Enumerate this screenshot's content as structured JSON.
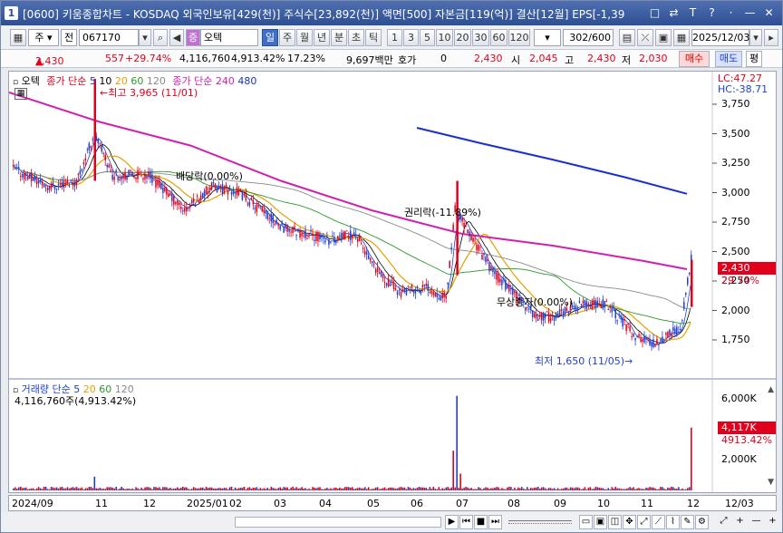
{
  "window": {
    "icon_label": "1",
    "title": "[0600] 키움종합차트 - KOSDAQ 외국인보유[429(천)] 주식수[23,892(천)] 액면[500] 자본금[119(억)] 결산[12월] EPS[-1,39",
    "title_buttons": [
      "□",
      "⇄",
      "T",
      "?",
      "·",
      "—",
      "✕"
    ]
  },
  "toolbar": {
    "market_type": "주",
    "board": "전",
    "stock_code": "067170",
    "stock_name": "오텍",
    "stock_tag": "증",
    "periods": [
      "일",
      "주",
      "월",
      "년",
      "분",
      "초",
      "틱"
    ],
    "active_period": "일",
    "intervals": [
      "1",
      "3",
      "5",
      "10",
      "20",
      "30",
      "60",
      "120"
    ],
    "view_count": "302",
    "view_total": "/600",
    "date": "2025/12/03"
  },
  "quote": {
    "price": "2,430",
    "change": "557",
    "change_rate": "+29.74%",
    "volume": "4,116,760",
    "volume_rate": "4,913.42%",
    "turnover": "17.23%",
    "amount": "9,697백만",
    "hoga_label": "호가",
    "hoga_value": "0",
    "hoga_price": "2,430",
    "open_label": "시",
    "open": "2,045",
    "high_label": "고",
    "high": "2,430",
    "low_label": "저",
    "low": "2,030",
    "buy_button": "매수",
    "sell_button": "매도",
    "eval_button": "평"
  },
  "colors": {
    "up": "#e0001b",
    "down": "#1f3fcf",
    "ma5": "#1f3fcf",
    "ma10": "#000000",
    "ma20": "#e8a000",
    "ma60": "#2a9a2a",
    "ma120": "#8a8a8a",
    "ma240": "#d020b0",
    "ma480": "#1a2fcf"
  },
  "price_panel": {
    "stock_label": "오텍",
    "legend_1": "종가 단순",
    "ma_1": [
      "5",
      "10",
      "20",
      "60",
      "120"
    ],
    "legend_2": "종가 단순",
    "ma_2": [
      "240",
      "480"
    ],
    "lc": "LC:47.27",
    "hc": "HC:-38.71",
    "high_note": "최고 3,965 (11/01)",
    "low_note": "최저 1,650 (11/05)",
    "dividend_note": "배당락(0.00%)",
    "rights_note": "권리락(-11.89%)",
    "bonus_note": "무상증자(0.00%)",
    "y_ticks": [
      "3,750",
      "3,500",
      "3,250",
      "3,000",
      "2,750",
      "2,500",
      "2,250",
      "2,000",
      "1,750"
    ],
    "last_price": "2,430",
    "last_rate": "29.74%"
  },
  "volume_panel": {
    "legend": "거래량 단순",
    "ma": [
      "5",
      "20",
      "60",
      "120"
    ],
    "value": "4,116,760주(4,913.42%)",
    "y_ticks": [
      "6,000K",
      "4,000K",
      "2,000K"
    ],
    "last_volume": "4,117K",
    "last_rate": "4913.42%"
  },
  "x_axis": [
    "2024/09",
    "11",
    "12",
    "2025/01",
    "02",
    "03",
    "04",
    "05",
    "06",
    "07",
    "08",
    "09",
    "10",
    "11",
    "12",
    "12/03"
  ]
}
